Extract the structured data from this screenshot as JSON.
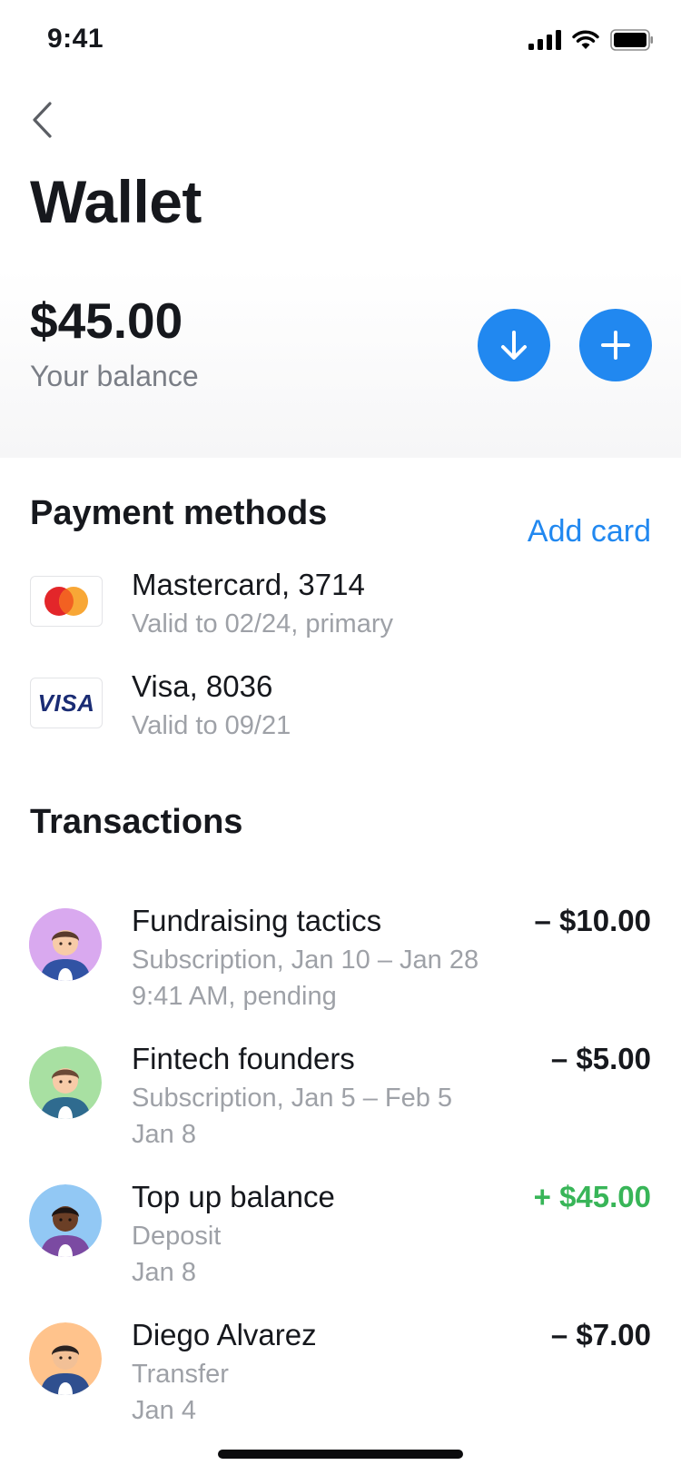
{
  "status_bar": {
    "time": "9:41"
  },
  "header": {
    "title": "Wallet"
  },
  "balance": {
    "amount": "$45.00",
    "label": "Your balance"
  },
  "payment_methods": {
    "title": "Payment methods",
    "add_label": "Add card",
    "cards": [
      {
        "brand_icon": "mastercard-logo",
        "title": "Mastercard, 3714",
        "subtitle": "Valid to 02/24, primary"
      },
      {
        "brand_icon": "visa-logo",
        "brand_text": "VISA",
        "title": "Visa, 8036",
        "subtitle": "Valid to 09/21"
      }
    ]
  },
  "transactions": {
    "title": "Transactions",
    "items": [
      {
        "title": "Fundraising tactics",
        "line1": "Subscription, Jan 10 – Jan 28",
        "line2": "9:41 AM, pending",
        "amount": "– $10.00",
        "avatar_color": "#d7a6ee"
      },
      {
        "title": "Fintech founders",
        "line1": "Subscription, Jan 5 – Feb 5",
        "line2": "Jan 8",
        "amount": "– $5.00",
        "avatar_color": "#a8e0a2"
      },
      {
        "title": "Top up balance",
        "line1": "Deposit",
        "line2": "Jan 8",
        "amount": "+ $45.00",
        "avatar_color": "#92c8f4"
      },
      {
        "title": "Diego Alvarez",
        "line1": "Transfer",
        "line2": "Jan 4",
        "amount": "– $7.00",
        "avatar_color": "#ffc38c"
      }
    ]
  },
  "colors": {
    "accent": "#2188f0",
    "positive": "#38b558",
    "text": "#16181d",
    "muted": "#9ea1a7"
  }
}
